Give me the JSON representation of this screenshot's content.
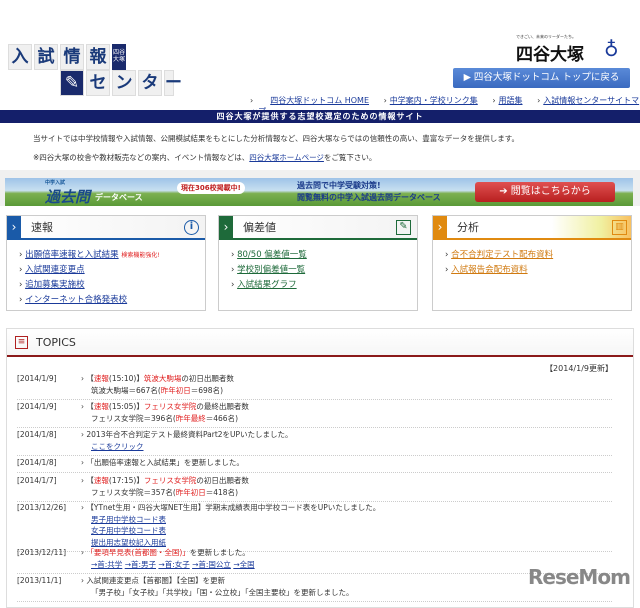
{
  "logo": {
    "chars1": [
      "入",
      "試",
      "情",
      "報"
    ],
    "mini": "四谷大塚",
    "chars2": [
      "セ",
      "ン",
      "タ",
      "ー"
    ]
  },
  "brand": {
    "tagline": "できごい、未来のリーダーたち。",
    "name": "四谷大塚"
  },
  "top_button": "▶ 四谷大塚ドットコム トップに戻る",
  "nav": [
    "四谷大塚ドットコム HOME",
    "中学案内・学校リンク集",
    "用語集",
    "入試情報センターサイトマップ"
  ],
  "banner": "四谷大塚が提供する志望校選定のための情報サイト",
  "intro": {
    "line1": "当サイトでは中学校情報や入試情報、公開模試結果をもとにした分析情報など、四谷大塚ならではの信頼性の高い、豊富なデータを提供します。",
    "line2_pre": "※四谷大塚の校舎や教材販売などの案内、イベント情報などは、",
    "line2_link": "四谷大塚ホームページ",
    "line2_post": "をご覧下さい。"
  },
  "promo": {
    "small": "中学入試",
    "title": "過去問",
    "sub": "データベース",
    "badge": "現在306校掲載中!",
    "copy1": "過去問で中学受験対策!",
    "copy2": "閲覧無料の中学入試過去問データベース",
    "button": "閲覧はこちらから"
  },
  "boxes": [
    {
      "title": "速報",
      "color": "#1a5aa8",
      "icon": "info-icon",
      "links": [
        "出願倍率速報と入試結果",
        "入試関連変更点",
        "追加募集実施校",
        "インターネット合格発表校"
      ],
      "note": "検索機能強化!"
    },
    {
      "title": "偏差値",
      "color": "#1e6a3a",
      "icon": "pencil-icon",
      "links": [
        "80/50 偏差値一覧",
        "学校別偏差値一覧",
        "入試結果グラフ"
      ]
    },
    {
      "title": "分析",
      "color": "#e08a10",
      "icon": "bar-chart-icon",
      "links": [
        "合不合判定テスト配布資料",
        "入試報告会配布資料"
      ]
    }
  ],
  "topics": {
    "title": "TOPICS",
    "updated": "【2014/1/9更新】",
    "items": [
      {
        "date": "[2014/1/9]",
        "lines": [
          [
            [
              "› 【",
              ""
            ],
            [
              "速報",
              "r"
            ],
            [
              "(15:10)】",
              ""
            ],
            [
              "筑波大駒場",
              "r"
            ],
            [
              "の初日出願者数",
              ""
            ]
          ],
          [
            [
              "筑波大駒場＝667名(",
              ""
            ],
            [
              "昨年初日",
              "r"
            ],
            [
              "＝698名)",
              ""
            ]
          ]
        ]
      },
      {
        "date": "[2014/1/9]",
        "lines": [
          [
            [
              "› 【",
              ""
            ],
            [
              "速報",
              "r"
            ],
            [
              "(15:05)】",
              ""
            ],
            [
              "フェリス女学院",
              "r"
            ],
            [
              "の最終出願者数",
              ""
            ]
          ],
          [
            [
              "フェリス女学院＝396名(",
              ""
            ],
            [
              "昨年最終",
              "r"
            ],
            [
              "＝466名)",
              ""
            ]
          ]
        ]
      },
      {
        "date": "[2014/1/8]",
        "lines": [
          [
            [
              "› 2013年合不合判定テスト最終資料Part2をUPいたしました。",
              ""
            ]
          ],
          [
            [
              "ここをクリック",
              "l"
            ]
          ]
        ]
      },
      {
        "date": "[2014/1/8]",
        "lines": [
          [
            [
              "› 「出願倍率速報と入試結果」を更新しました。",
              ""
            ]
          ]
        ]
      },
      {
        "date": "[2014/1/7]",
        "lines": [
          [
            [
              "› 【",
              ""
            ],
            [
              "速報",
              "r"
            ],
            [
              "(17:15)】",
              ""
            ],
            [
              "フェリス女学院",
              "r"
            ],
            [
              "の初日出願者数",
              ""
            ]
          ],
          [
            [
              "フェリス女学院＝357名(",
              ""
            ],
            [
              "昨年初日",
              "r"
            ],
            [
              "＝418名)",
              ""
            ]
          ]
        ]
      },
      {
        "date": "[2013/12/26]",
        "lines": [
          [
            [
              "› 【YTnet生用・四谷大塚NET生用】学期末成績表用中学校コード表をUPいたしました。",
              ""
            ]
          ],
          [
            [
              "男子用中学校コード表",
              "l"
            ]
          ],
          [
            [
              "女子用中学校コード表",
              "l"
            ]
          ],
          [
            [
              "提出用志望校記入用紙",
              "l"
            ]
          ]
        ]
      },
      {
        "date": "[2013/12/11]",
        "lines": [
          [
            [
              "› ",
              ""
            ],
            [
              "「要項早見表(首都圏・全国)」",
              "r"
            ],
            [
              "を更新しました。",
              ""
            ]
          ],
          [
            [
              "→首:共学",
              "l"
            ],
            [
              " ",
              ""
            ],
            [
              "→首:男子",
              "l"
            ],
            [
              " ",
              ""
            ],
            [
              "→首:女子",
              "l"
            ],
            [
              " ",
              ""
            ],
            [
              "→首:国公立",
              "l"
            ],
            [
              " ",
              ""
            ],
            [
              "→全国",
              "l"
            ]
          ]
        ]
      },
      {
        "date": "[2013/11/1]",
        "lines": [
          [
            [
              "› 入試関連変更点【首都圏】【全国】を更新",
              ""
            ]
          ],
          [
            [
              "「男子校」「女子校」「共学校」「国・公立校」「全国主要校」を更新しました。",
              ""
            ]
          ]
        ]
      }
    ]
  },
  "watermark": "ReseMom"
}
